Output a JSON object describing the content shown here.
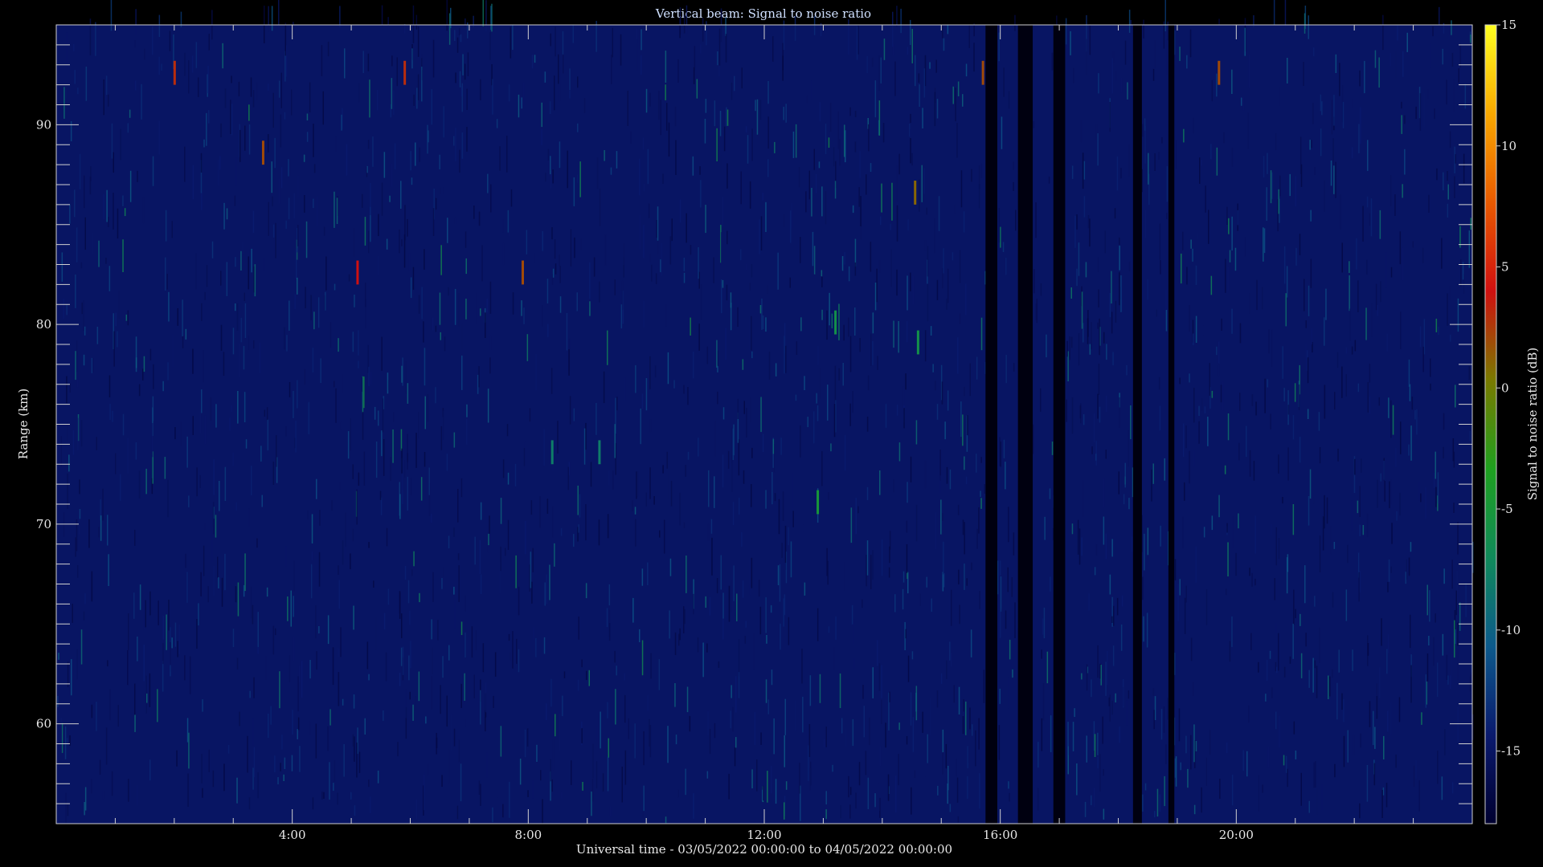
{
  "chart_data": {
    "type": "heatmap",
    "title": "Vertical beam: Signal to noise ratio",
    "xlabel": "Universal time - 03/05/2022 00:00:00 to 04/05/2022 00:00:00",
    "ylabel": "Range (km)",
    "xlim": [
      0,
      24
    ],
    "x_tick_values": [
      4,
      8,
      12,
      16,
      20
    ],
    "x_tick_labels": [
      "4:00",
      "8:00",
      "12:00",
      "16:00",
      "20:00"
    ],
    "ylim": [
      55,
      95
    ],
    "y_tick_values": [
      60,
      70,
      80,
      90
    ],
    "y_tick_labels": [
      "60",
      "70",
      "80",
      "90"
    ],
    "colorbar": {
      "label": "Signal to noise ratio (dB)",
      "range": [
        -18,
        15
      ],
      "tick_values": [
        -15,
        -10,
        -5,
        0,
        5,
        10,
        15
      ],
      "tick_labels": [
        "-15",
        "-10",
        "-5",
        "0",
        "5",
        "10",
        "15"
      ],
      "colors": [
        "#000030",
        "#0a1a6e",
        "#0c5a8c",
        "#108a5a",
        "#1fa01f",
        "#7a7a00",
        "#d01010",
        "#e85a00",
        "#f8a800",
        "#ffff20"
      ]
    },
    "background_level_db": -15,
    "data_gaps_hours": [
      [
        15.75,
        15.95
      ],
      [
        16.3,
        16.55
      ],
      [
        16.9,
        17.1
      ],
      [
        18.25,
        18.4
      ],
      [
        18.85,
        18.95
      ]
    ],
    "notable_echoes": [
      {
        "time": 12.9,
        "range": 70.5,
        "snr": -5
      },
      {
        "time": 8.4,
        "range": 73,
        "snr": -8
      },
      {
        "time": 9.2,
        "range": 73,
        "snr": -8
      },
      {
        "time": 5.9,
        "range": 92,
        "snr": 3
      },
      {
        "time": 2.0,
        "range": 92,
        "snr": 3
      },
      {
        "time": 5.1,
        "range": 82,
        "snr": 4
      },
      {
        "time": 3.5,
        "range": 88,
        "snr": 2
      },
      {
        "time": 7.9,
        "range": 82,
        "snr": 2
      },
      {
        "time": 14.55,
        "range": 86,
        "snr": 1
      },
      {
        "time": 15.7,
        "range": 92,
        "snr": 2
      },
      {
        "time": 19.7,
        "range": 92,
        "snr": 2
      },
      {
        "time": 13.2,
        "range": 79.5,
        "snr": -6
      },
      {
        "time": 14.6,
        "range": 78.5,
        "snr": -6
      }
    ]
  }
}
